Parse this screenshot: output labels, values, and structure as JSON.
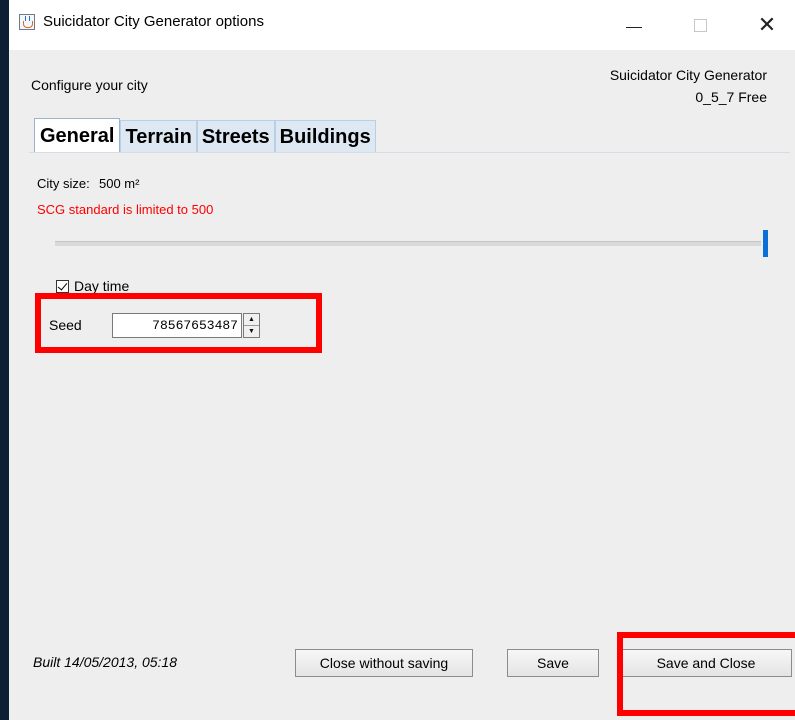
{
  "window": {
    "title": "Suicidator City Generator options",
    "controls": {
      "minimize": "—",
      "maximize": "□",
      "close": "✕"
    },
    "icon": "java-app-icon"
  },
  "header": {
    "configure_label": "Configure your city",
    "brand_name": "Suicidator City Generator",
    "version": "0_5_7 Free"
  },
  "tabs": [
    {
      "label": "General",
      "active": true
    },
    {
      "label": "Terrain",
      "active": false
    },
    {
      "label": "Streets",
      "active": false
    },
    {
      "label": "Buildings",
      "active": false
    }
  ],
  "general": {
    "city_size_label": "City size:",
    "city_size_value": "500 m²",
    "limit_note": "SCG standard is limited to 500",
    "slider_level": 1.0,
    "day_time_label": "Day time",
    "day_time_checked": true,
    "seed_label": "Seed",
    "seed_value": "78567653487"
  },
  "footer": {
    "built": "Built 14/05/2013, 05:18",
    "close_without_saving": "Close without saving",
    "save": "Save",
    "save_and_close": "Save and Close"
  },
  "colors": {
    "accent": "#0a6fd6",
    "warning_text": "#ff0000",
    "highlight": "#ff0000"
  }
}
